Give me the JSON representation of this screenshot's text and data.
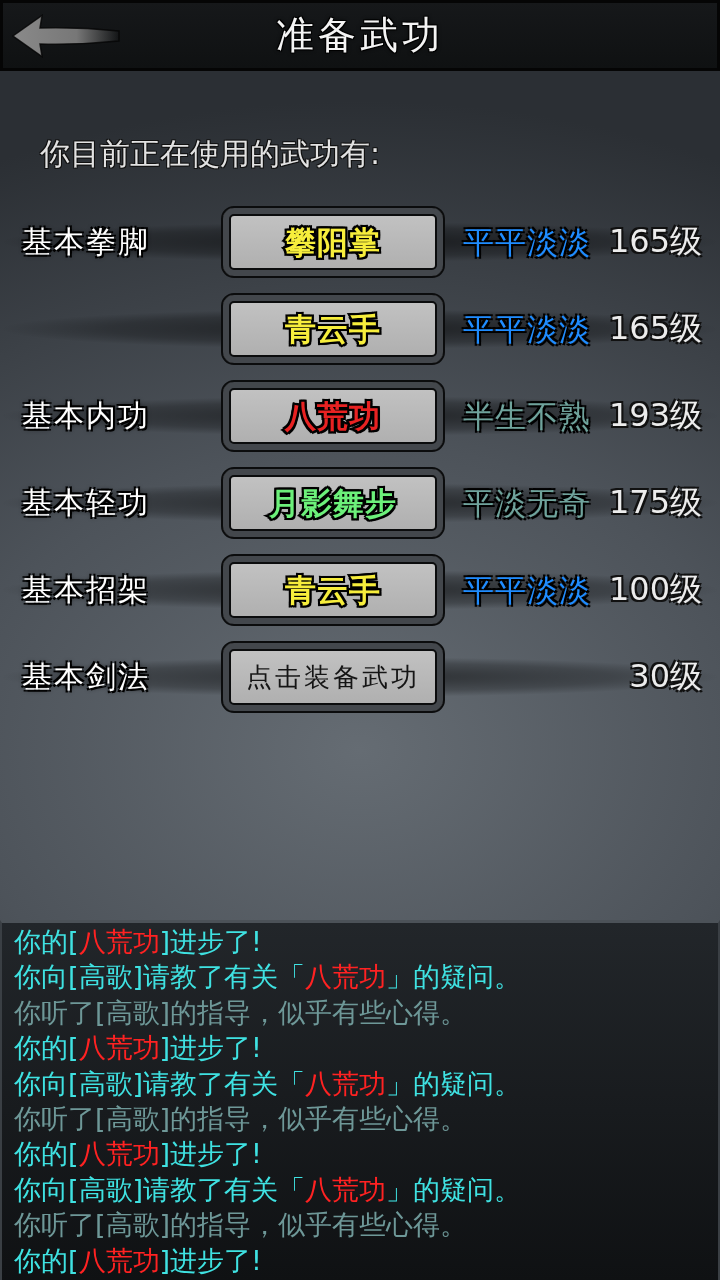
{
  "header": {
    "title": "准备武功"
  },
  "intro": "你目前正在使用的武功有:",
  "slots": [
    {
      "category": "基本拳脚",
      "kind": "equipped",
      "skill": {
        "name": "攀阳掌",
        "color": "#f7ee3c"
      },
      "rating": {
        "text": "平平淡淡",
        "color": "#1f8cff"
      },
      "grade": "165级"
    },
    {
      "kind": "equipped",
      "skill": {
        "name": "青云手",
        "color": "#f7ee3c"
      },
      "rating": {
        "text": "平平淡淡",
        "color": "#1f8cff"
      },
      "grade": "165级"
    },
    {
      "category": "基本内功",
      "kind": "equipped",
      "skill": {
        "name": "八荒功",
        "color": "#e82222"
      },
      "rating": {
        "text": "半生不熟",
        "color": "#6fa39c"
      },
      "grade": "193级"
    },
    {
      "category": "基本轻功",
      "kind": "equipped",
      "skill": {
        "name": "月影舞步",
        "color": "#6cf07a"
      },
      "rating": {
        "text": "平淡无奇",
        "color": "#6fa39c"
      },
      "grade": "175级"
    },
    {
      "category": "基本招架",
      "kind": "equipped",
      "skill": {
        "name": "青云手",
        "color": "#f7ee3c"
      },
      "rating": {
        "text": "平平淡淡",
        "color": "#1f8cff"
      },
      "grade": "100级"
    },
    {
      "category": "基本剑法",
      "kind": "empty",
      "skill": {
        "name": "点击装备武功"
      },
      "grade": "30级"
    }
  ],
  "log": [
    {
      "segments": [
        {
          "text": "你的[",
          "color": "#3fe2e2"
        },
        {
          "text": "八荒功",
          "color": "#ff2222"
        },
        {
          "text": "]进步了!",
          "color": "#3fe2e2"
        }
      ]
    },
    {
      "segments": [
        {
          "text": "你向[高歌]请教了有关「",
          "color": "#3fe2e2"
        },
        {
          "text": "八荒功",
          "color": "#ff2222"
        },
        {
          "text": "」的疑问。",
          "color": "#3fe2e2"
        }
      ]
    },
    {
      "segments": [
        {
          "text": "你听了[高歌]的指导，似乎有些心得。",
          "color": "#6e9898"
        }
      ]
    },
    {
      "segments": [
        {
          "text": "你的[",
          "color": "#3fe2e2"
        },
        {
          "text": "八荒功",
          "color": "#ff2222"
        },
        {
          "text": "]进步了!",
          "color": "#3fe2e2"
        }
      ]
    },
    {
      "segments": [
        {
          "text": "你向[高歌]请教了有关「",
          "color": "#3fe2e2"
        },
        {
          "text": "八荒功",
          "color": "#ff2222"
        },
        {
          "text": "」的疑问。",
          "color": "#3fe2e2"
        }
      ]
    },
    {
      "segments": [
        {
          "text": "你听了[高歌]的指导，似乎有些心得。",
          "color": "#6e9898"
        }
      ]
    },
    {
      "segments": [
        {
          "text": "你的[",
          "color": "#3fe2e2"
        },
        {
          "text": "八荒功",
          "color": "#ff2222"
        },
        {
          "text": "]进步了!",
          "color": "#3fe2e2"
        }
      ]
    },
    {
      "segments": [
        {
          "text": "你向[高歌]请教了有关「",
          "color": "#3fe2e2"
        },
        {
          "text": "八荒功",
          "color": "#ff2222"
        },
        {
          "text": "」的疑问。",
          "color": "#3fe2e2"
        }
      ]
    },
    {
      "segments": [
        {
          "text": "你听了[高歌]的指导，似乎有些心得。",
          "color": "#6e9898"
        }
      ]
    },
    {
      "segments": [
        {
          "text": "你的[",
          "color": "#3fe2e2"
        },
        {
          "text": "八荒功",
          "color": "#ff2222"
        },
        {
          "text": "]进步了!",
          "color": "#3fe2e2"
        }
      ]
    }
  ]
}
